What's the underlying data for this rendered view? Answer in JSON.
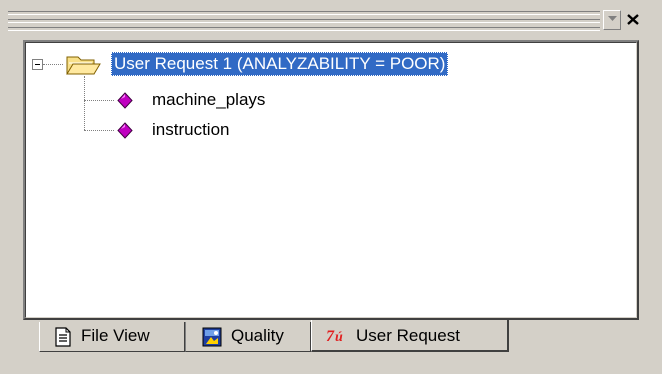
{
  "tree": {
    "root": {
      "label": "User Request 1 (ANALYZABILITY = POOR)",
      "icon": "open-folder-icon",
      "expanded": true,
      "selected": true
    },
    "children": [
      {
        "label": "machine_plays",
        "icon": "magenta-diamond-icon"
      },
      {
        "label": "instruction",
        "icon": "magenta-diamond-icon"
      }
    ]
  },
  "tabs": [
    {
      "label": "File View",
      "icon": "document-icon",
      "active": false
    },
    {
      "label": "Quality",
      "icon": "quality-icon",
      "active": false
    },
    {
      "label": "User Request",
      "icon": "user-request-icon",
      "active": true
    }
  ],
  "colors": {
    "selection": "#316ac5",
    "panel_bg": "#ffffff",
    "chrome_bg": "#d4d0c8",
    "leaf_icon": "#c000c0"
  }
}
